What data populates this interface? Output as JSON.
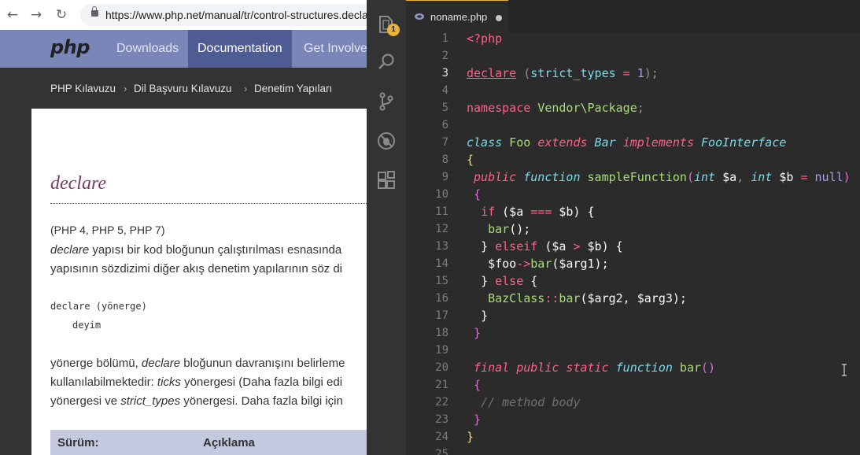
{
  "browser": {
    "url": "https://www.php.net/manual/tr/control-structures.declare.php",
    "nav": {
      "logo": "php",
      "items": [
        "Downloads",
        "Documentation",
        "Get Involved"
      ]
    },
    "breadcrumb": [
      "PHP Kılavuzu",
      "Dil Başvuru Kılavuzu",
      "Denetim Yapıları"
    ],
    "page": {
      "title": "declare",
      "versions": "(PHP 4, PHP 5, PHP 7)",
      "p1_l1_em": "declare",
      "p1_l1_rest": " yapısı bir kod bloğunun çalıştırılması esnasında",
      "p1_l2": "yapısının sözdizimi diğer akış denetim yapılarının söz di",
      "syntax_l1": "declare (yönerge)",
      "syntax_l2": "deyim",
      "p2_l1_a": "yönerge bölümü, ",
      "p2_l1_em": "declare",
      "p2_l1_b": " bloğunun davranışını belirleme",
      "p2_l2_a": "kullanılabilmektedir: ",
      "p2_l2_em": "ticks",
      "p2_l2_b": " yönergesi (Daha fazla bilgi edi",
      "p2_l3_a": "yönergesi ve ",
      "p2_l3_em": "strict_types",
      "p2_l3_b": " yönergesi. Daha fazla bilgi için",
      "table_headers": [
        "Sürüm:",
        "Açıklama"
      ]
    }
  },
  "editor": {
    "tab_label": "noname.php",
    "badge_count": "1",
    "line_numbers": [
      "1",
      "2",
      "3",
      "4",
      "5",
      "6",
      "7",
      "8",
      "9",
      "10",
      "11",
      "12",
      "13",
      "14",
      "15",
      "16",
      "17",
      "18",
      "19",
      "20",
      "21",
      "22",
      "23",
      "24",
      "25"
    ],
    "active_line": "3",
    "code": {
      "l1": "<?php",
      "l3_kw": "declare",
      "l3_a": " (",
      "l3_name": "strict_types",
      "l3_eq": " = ",
      "l3_num": "1",
      "l3_b": ");",
      "l5_kw": "namespace",
      "l5_ns": " Vendor\\Package",
      "l5_semi": ";",
      "l7_class": "class",
      "l7_name": " Foo ",
      "l7_extends": "extends",
      "l7_bar": " Bar ",
      "l7_impl": "implements",
      "l7_iface": " FooInterface",
      "l8": "{",
      "l9_public": "public",
      "l9_function": " function",
      "l9_name": " sampleFunction",
      "l9_open": "(",
      "l9_int1": "int",
      "l9_a": " $a",
      "l9_comma": ", ",
      "l9_int2": "int",
      "l9_b": " $b",
      "l9_eq": " = ",
      "l9_null": "null",
      "l9_close": ")",
      "l10": "{",
      "l11_if": "if",
      "l11_a": " ($a ",
      "l11_op": "===",
      "l11_b": " $b) {",
      "l12_fn": "bar",
      "l12_rest": "();",
      "l13_close": "} ",
      "l13_elseif": "elseif",
      "l13_a": " ($a ",
      "l13_op": ">",
      "l13_b": " $b) {",
      "l14_var": "$foo",
      "l14_arrow": "->",
      "l14_fn": "bar",
      "l14_rest": "($arg1);",
      "l15_close": "} ",
      "l15_else": "else",
      "l15_open": " {",
      "l16_cls": "BazClass",
      "l16_dc": "::",
      "l16_fn": "bar",
      "l16_rest": "($arg2, $arg3);",
      "l17": "}",
      "l18": "}",
      "l20_final": "final",
      "l20_public": " public",
      "l20_static": " static",
      "l20_function": " function",
      "l20_name": " bar",
      "l20_parens": "()",
      "l21": "{",
      "l22": "// method body",
      "l23": "}",
      "l24": "}"
    }
  },
  "colors": {
    "php_nav": "#7a86b8",
    "php_nav_active": "#4f5b93",
    "editor_bg": "#2b2b2b",
    "keyword": "#ff6188",
    "class_name": "#78dce8",
    "function": "#a9dc76",
    "number": "#ab9df2"
  }
}
